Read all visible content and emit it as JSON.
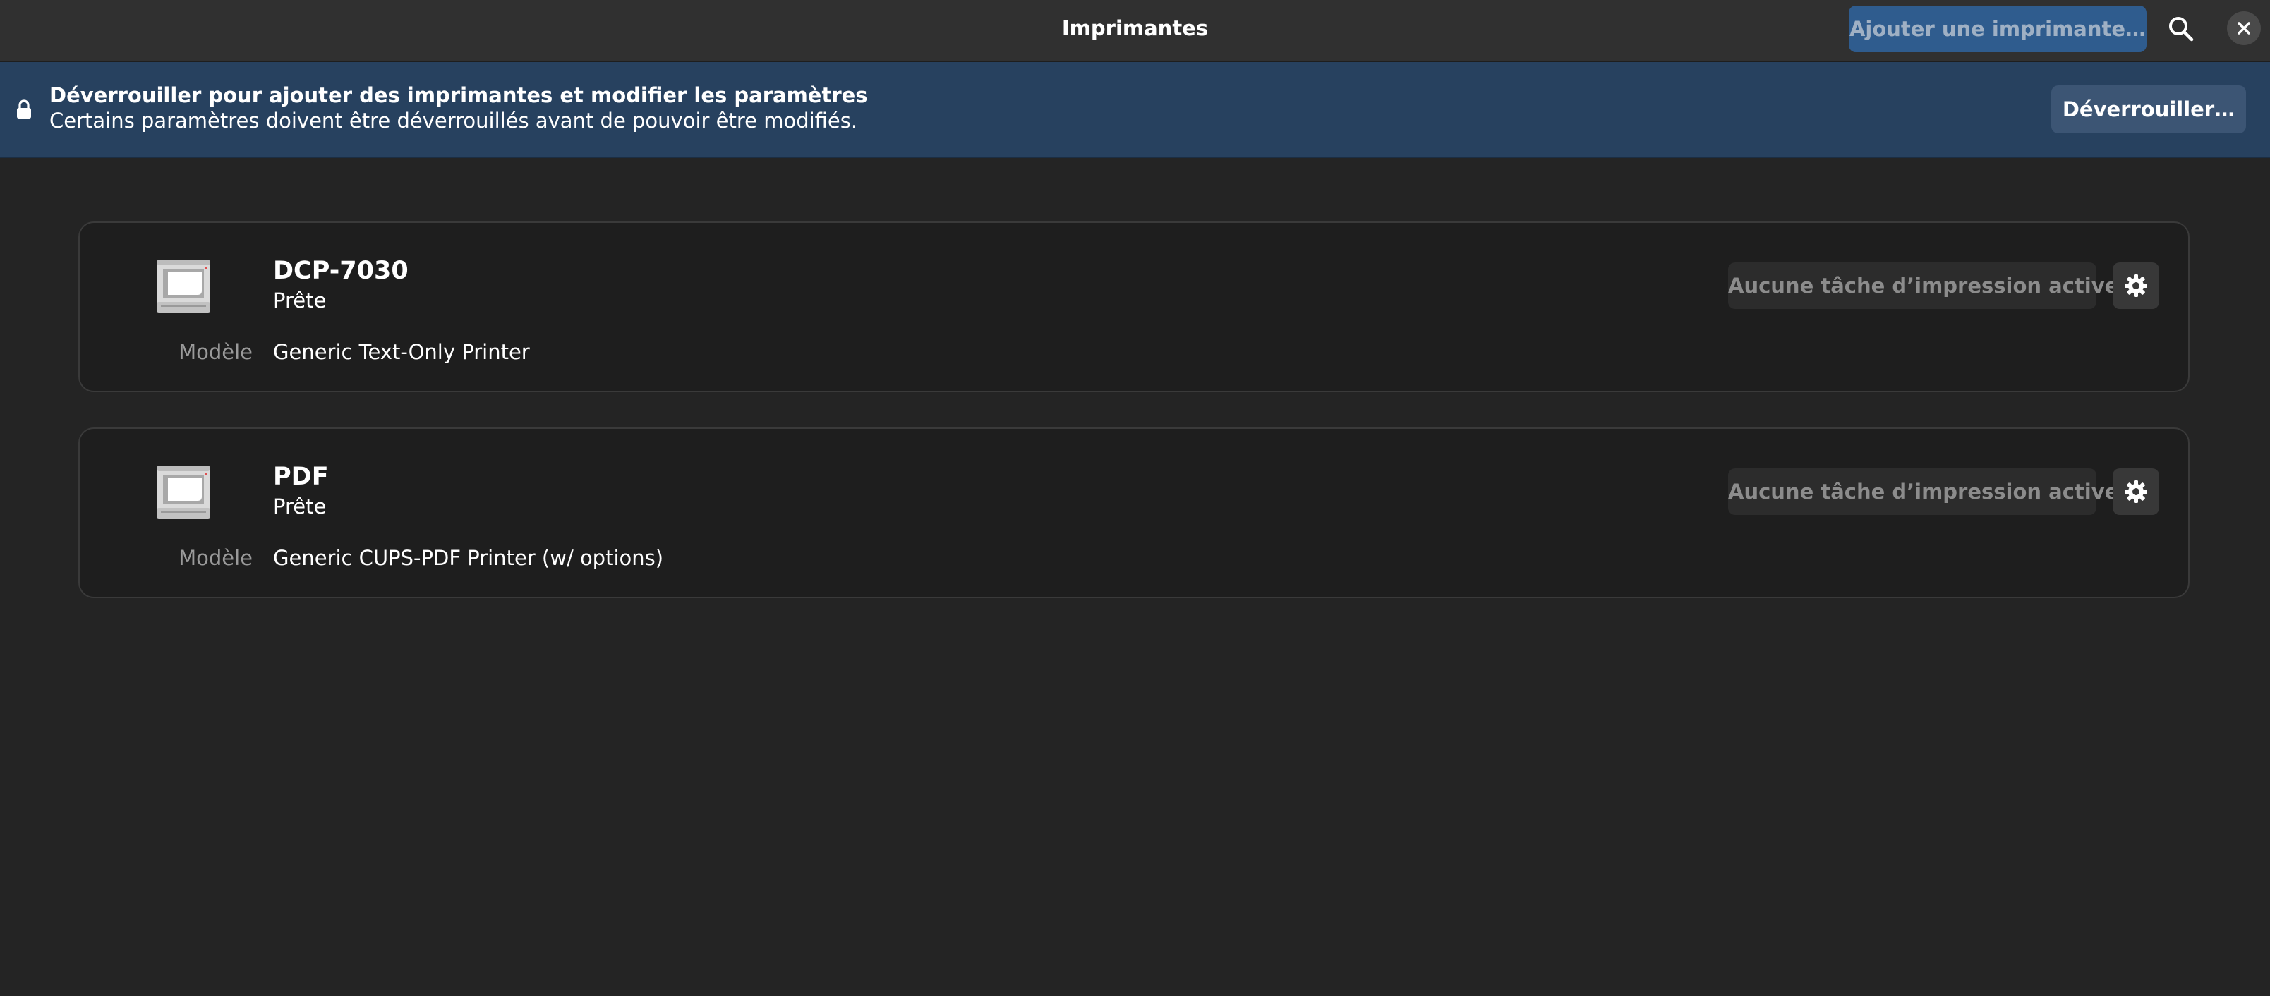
{
  "window": {
    "title": "Imprimantes",
    "add_printer_label": "Ajouter une imprimante…",
    "search_icon": "search-icon",
    "close_icon": "close-icon"
  },
  "banner": {
    "icon": "lock-icon",
    "title": "Déverrouiller pour ajouter des imprimantes et modifier les paramètres",
    "subtitle": "Certains paramètres doivent être déverrouillés avant de pouvoir être modifiés.",
    "unlock_label": "Déverrouiller…"
  },
  "printers": [
    {
      "name": "DCP-7030",
      "status": "Prête",
      "model_label": "Modèle",
      "model": "Generic Text-Only Printer",
      "jobs_label": "Aucune tâche d’impression active",
      "icon": "printer-icon",
      "settings_icon": "gear-icon"
    },
    {
      "name": "PDF",
      "status": "Prête",
      "model_label": "Modèle",
      "model": "Generic CUPS-PDF Printer (w/ options)",
      "jobs_label": "Aucune tâche d’impression active",
      "icon": "printer-icon",
      "settings_icon": "gear-icon"
    }
  ],
  "colors": {
    "background": "#242424",
    "headerbar": "#303030",
    "banner": "#27415f",
    "accent_button": "#2f5c8e",
    "card": "#1e1e1e"
  }
}
